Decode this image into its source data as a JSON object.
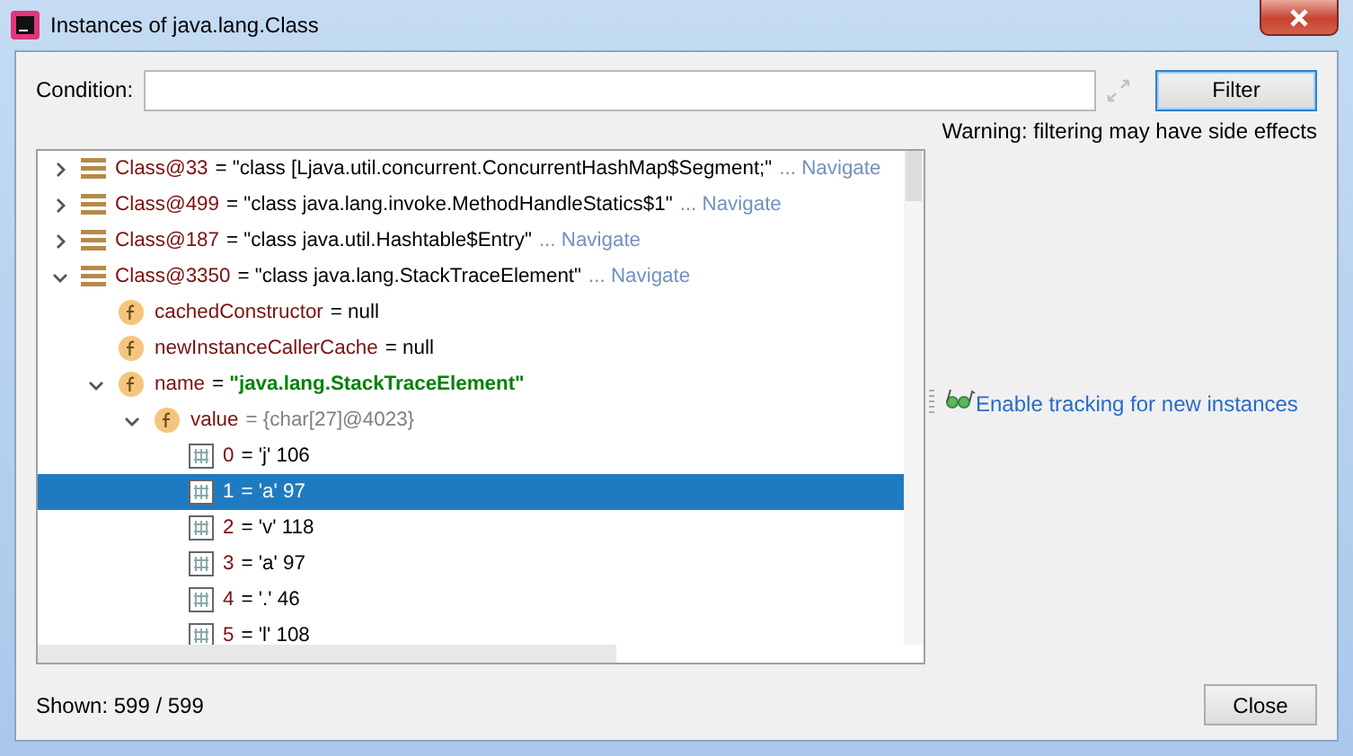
{
  "window": {
    "title": "Instances of java.lang.Class"
  },
  "condition": {
    "label": "Condition:"
  },
  "filter_button": "Filter",
  "warning": "Warning: filtering may have side effects",
  "tree": [
    {
      "kind": "object",
      "name": "Class@33",
      "value": "= \"class [Ljava.util.concurrent.ConcurrentHashMap$Segment;\"",
      "link": "... Navigate",
      "expanded": false,
      "selected": false
    },
    {
      "kind": "object",
      "name": "Class@499",
      "value": "= \"class java.lang.invoke.MethodHandleStatics$1\"",
      "link": "... Navigate",
      "expanded": false,
      "selected": false
    },
    {
      "kind": "object",
      "name": "Class@187",
      "value": "= \"class java.util.Hashtable$Entry\"",
      "link": "... Navigate",
      "expanded": false,
      "selected": false
    },
    {
      "kind": "object",
      "name": "Class@3350",
      "value": "= \"class java.lang.StackTraceElement\"",
      "link": "... Navigate",
      "expanded": true,
      "selected": false,
      "children": [
        {
          "kind": "field",
          "name": "cachedConstructor",
          "value": "= null",
          "selected": false
        },
        {
          "kind": "field",
          "name": "newInstanceCallerCache",
          "value": "= null",
          "selected": false
        },
        {
          "kind": "string",
          "name": "name",
          "value": "= **\"java.lang.StackTraceElement\"**",
          "expanded": true,
          "selected": false,
          "children": [
            {
              "kind": "reference",
              "name": "value",
              "value": "= {char[27]@4023}",
              "expanded": true,
              "selected": false,
              "children": [
                {
                  "kind": "element",
                  "name": "0",
                  "value": "= 'j' 106",
                  "selected": false
                },
                {
                  "kind": "element",
                  "name": "1",
                  "value": "= 'a' 97",
                  "selected": true
                },
                {
                  "kind": "element",
                  "name": "2",
                  "value": "= 'v' 118",
                  "selected": false
                },
                {
                  "kind": "element",
                  "name": "3",
                  "value": "= 'a' 97",
                  "selected": false
                },
                {
                  "kind": "element",
                  "name": "4",
                  "value": "= '.' 46",
                  "selected": false
                },
                {
                  "kind": "element",
                  "name": "5",
                  "value": "= 'l' 108",
                  "selected": false
                }
              ]
            }
          ]
        }
      ]
    }
  ],
  "tracking_link": "Enable tracking for new instances",
  "shown": "Shown: 599 / 599",
  "close_button": "Close"
}
